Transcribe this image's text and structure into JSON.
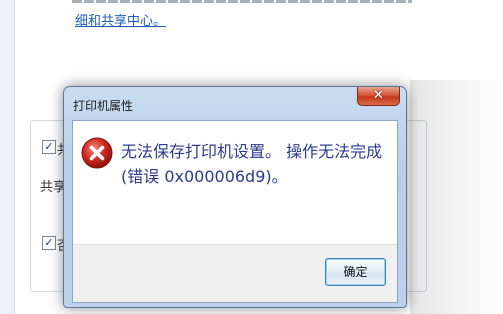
{
  "background": {
    "link_text": "细和共享中心。",
    "partial_chars": [
      "共",
      "共享",
      "否"
    ]
  },
  "dialog": {
    "title": "打印机属性",
    "close_symbol": "✕",
    "message": "无法保存打印机设置。 操作无法完成(错误 0x000006d9)。",
    "ok_label": "确定",
    "icon": "error-x-icon",
    "colors": {
      "icon_red": "#d02c20",
      "message_text": "#2a3b8f",
      "close_button": "#c4391e"
    }
  }
}
